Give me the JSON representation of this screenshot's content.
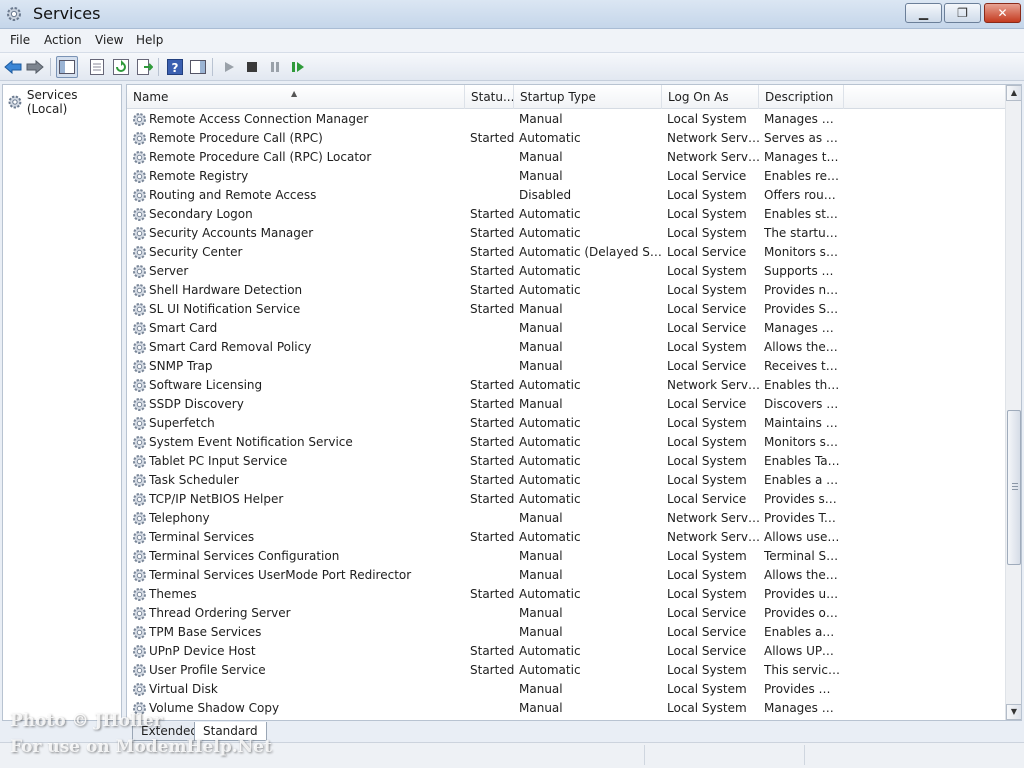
{
  "window": {
    "title": "Services"
  },
  "menu": [
    "File",
    "Action",
    "View",
    "Help"
  ],
  "tree": {
    "root_label": "Services (Local)"
  },
  "columns": [
    "Name",
    "Statu...",
    "Startup Type",
    "Log On As",
    "Description"
  ],
  "rows": [
    [
      "Remote Access Connection Manager",
      "",
      "Manual",
      "Local System",
      "Manages di..."
    ],
    [
      "Remote Procedure Call (RPC)",
      "Started",
      "Automatic",
      "Network Service",
      "Serves as th..."
    ],
    [
      "Remote Procedure Call (RPC) Locator",
      "",
      "Manual",
      "Network Service",
      "Manages th..."
    ],
    [
      "Remote Registry",
      "",
      "Manual",
      "Local Service",
      "Enables rem..."
    ],
    [
      "Routing and Remote Access",
      "",
      "Disabled",
      "Local System",
      "Offers routi..."
    ],
    [
      "Secondary Logon",
      "Started",
      "Automatic",
      "Local System",
      "Enables star..."
    ],
    [
      "Security Accounts Manager",
      "Started",
      "Automatic",
      "Local System",
      "The startup ..."
    ],
    [
      "Security Center",
      "Started",
      "Automatic (Delayed Start)",
      "Local Service",
      "Monitors sy..."
    ],
    [
      "Server",
      "Started",
      "Automatic",
      "Local System",
      "Supports fil..."
    ],
    [
      "Shell Hardware Detection",
      "Started",
      "Automatic",
      "Local System",
      "Provides no..."
    ],
    [
      "SL UI Notification Service",
      "Started",
      "Manual",
      "Local Service",
      "Provides So..."
    ],
    [
      "Smart Card",
      "",
      "Manual",
      "Local Service",
      "Manages ac..."
    ],
    [
      "Smart Card Removal Policy",
      "",
      "Manual",
      "Local System",
      "Allows the s..."
    ],
    [
      "SNMP Trap",
      "",
      "Manual",
      "Local Service",
      "Receives tra..."
    ],
    [
      "Software Licensing",
      "Started",
      "Automatic",
      "Network Service",
      "Enables the ..."
    ],
    [
      "SSDP Discovery",
      "Started",
      "Manual",
      "Local Service",
      "Discovers n..."
    ],
    [
      "Superfetch",
      "Started",
      "Automatic",
      "Local System",
      "Maintains a..."
    ],
    [
      "System Event Notification Service",
      "Started",
      "Automatic",
      "Local System",
      "Monitors sy..."
    ],
    [
      "Tablet PC Input Service",
      "Started",
      "Automatic",
      "Local System",
      "Enables Tab..."
    ],
    [
      "Task Scheduler",
      "Started",
      "Automatic",
      "Local System",
      "Enables a us..."
    ],
    [
      "TCP/IP NetBIOS Helper",
      "Started",
      "Automatic",
      "Local Service",
      "Provides su..."
    ],
    [
      "Telephony",
      "",
      "Manual",
      "Network Service",
      "Provides Tel..."
    ],
    [
      "Terminal Services",
      "Started",
      "Automatic",
      "Network Service",
      "Allows user..."
    ],
    [
      "Terminal Services Configuration",
      "",
      "Manual",
      "Local System",
      "Terminal Se..."
    ],
    [
      "Terminal Services UserMode Port Redirector",
      "",
      "Manual",
      "Local System",
      "Allows the r..."
    ],
    [
      "Themes",
      "Started",
      "Automatic",
      "Local System",
      "Provides us..."
    ],
    [
      "Thread Ordering Server",
      "",
      "Manual",
      "Local Service",
      "Provides or..."
    ],
    [
      "TPM Base Services",
      "",
      "Manual",
      "Local Service",
      "Enables acc..."
    ],
    [
      "UPnP Device Host",
      "Started",
      "Automatic",
      "Local Service",
      "Allows UPn..."
    ],
    [
      "User Profile Service",
      "Started",
      "Automatic",
      "Local System",
      "This service ..."
    ],
    [
      "Virtual Disk",
      "",
      "Manual",
      "Local System",
      "Provides m..."
    ],
    [
      "Volume Shadow Copy",
      "",
      "Manual",
      "Local System",
      "Manages an..."
    ]
  ],
  "tabs": [
    "Extended",
    "Standard"
  ],
  "watermark": [
    "Photo © JHoller",
    "For use on ModemHelp.Net"
  ]
}
